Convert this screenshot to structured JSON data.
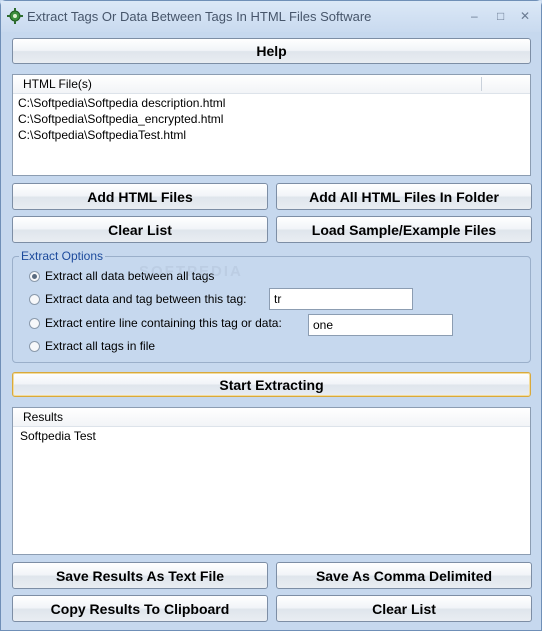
{
  "window": {
    "title": "Extract Tags Or Data Between Tags In HTML Files Software",
    "controls": {
      "minimize": "–",
      "maximize": "□",
      "close": "✕"
    }
  },
  "help_button": "Help",
  "html_files": {
    "header": "HTML File(s)",
    "items": [
      "C:\\Softpedia\\Softpedia description.html",
      "C:\\Softpedia\\Softpedia_encrypted.html",
      "C:\\Softpedia\\SoftpediaTest.html"
    ]
  },
  "file_buttons": {
    "add_html_files": "Add HTML Files",
    "add_all_in_folder": "Add All HTML Files In Folder",
    "clear_list": "Clear List",
    "load_sample": "Load Sample/Example Files"
  },
  "extract_options": {
    "label": "Extract Options",
    "option_all_between": "Extract all data between all tags",
    "option_data_and_tag": "Extract data and tag between this tag:",
    "tag_value": "tr",
    "option_entire_line": "Extract entire line containing this tag or data:",
    "line_value": "one",
    "option_all_tags": "Extract all tags in file",
    "selected": "option_all_between"
  },
  "start_button": "Start Extracting",
  "results": {
    "header": "Results",
    "items": [
      "Softpedia Test"
    ]
  },
  "bottom_buttons": {
    "save_text": "Save Results As Text File",
    "save_csv": "Save As Comma Delimited",
    "copy_clipboard": "Copy Results To Clipboard",
    "clear_list": "Clear List"
  },
  "watermark": "SOFTPEDIA",
  "icons": {
    "app": "gear-tag-app-icon"
  }
}
